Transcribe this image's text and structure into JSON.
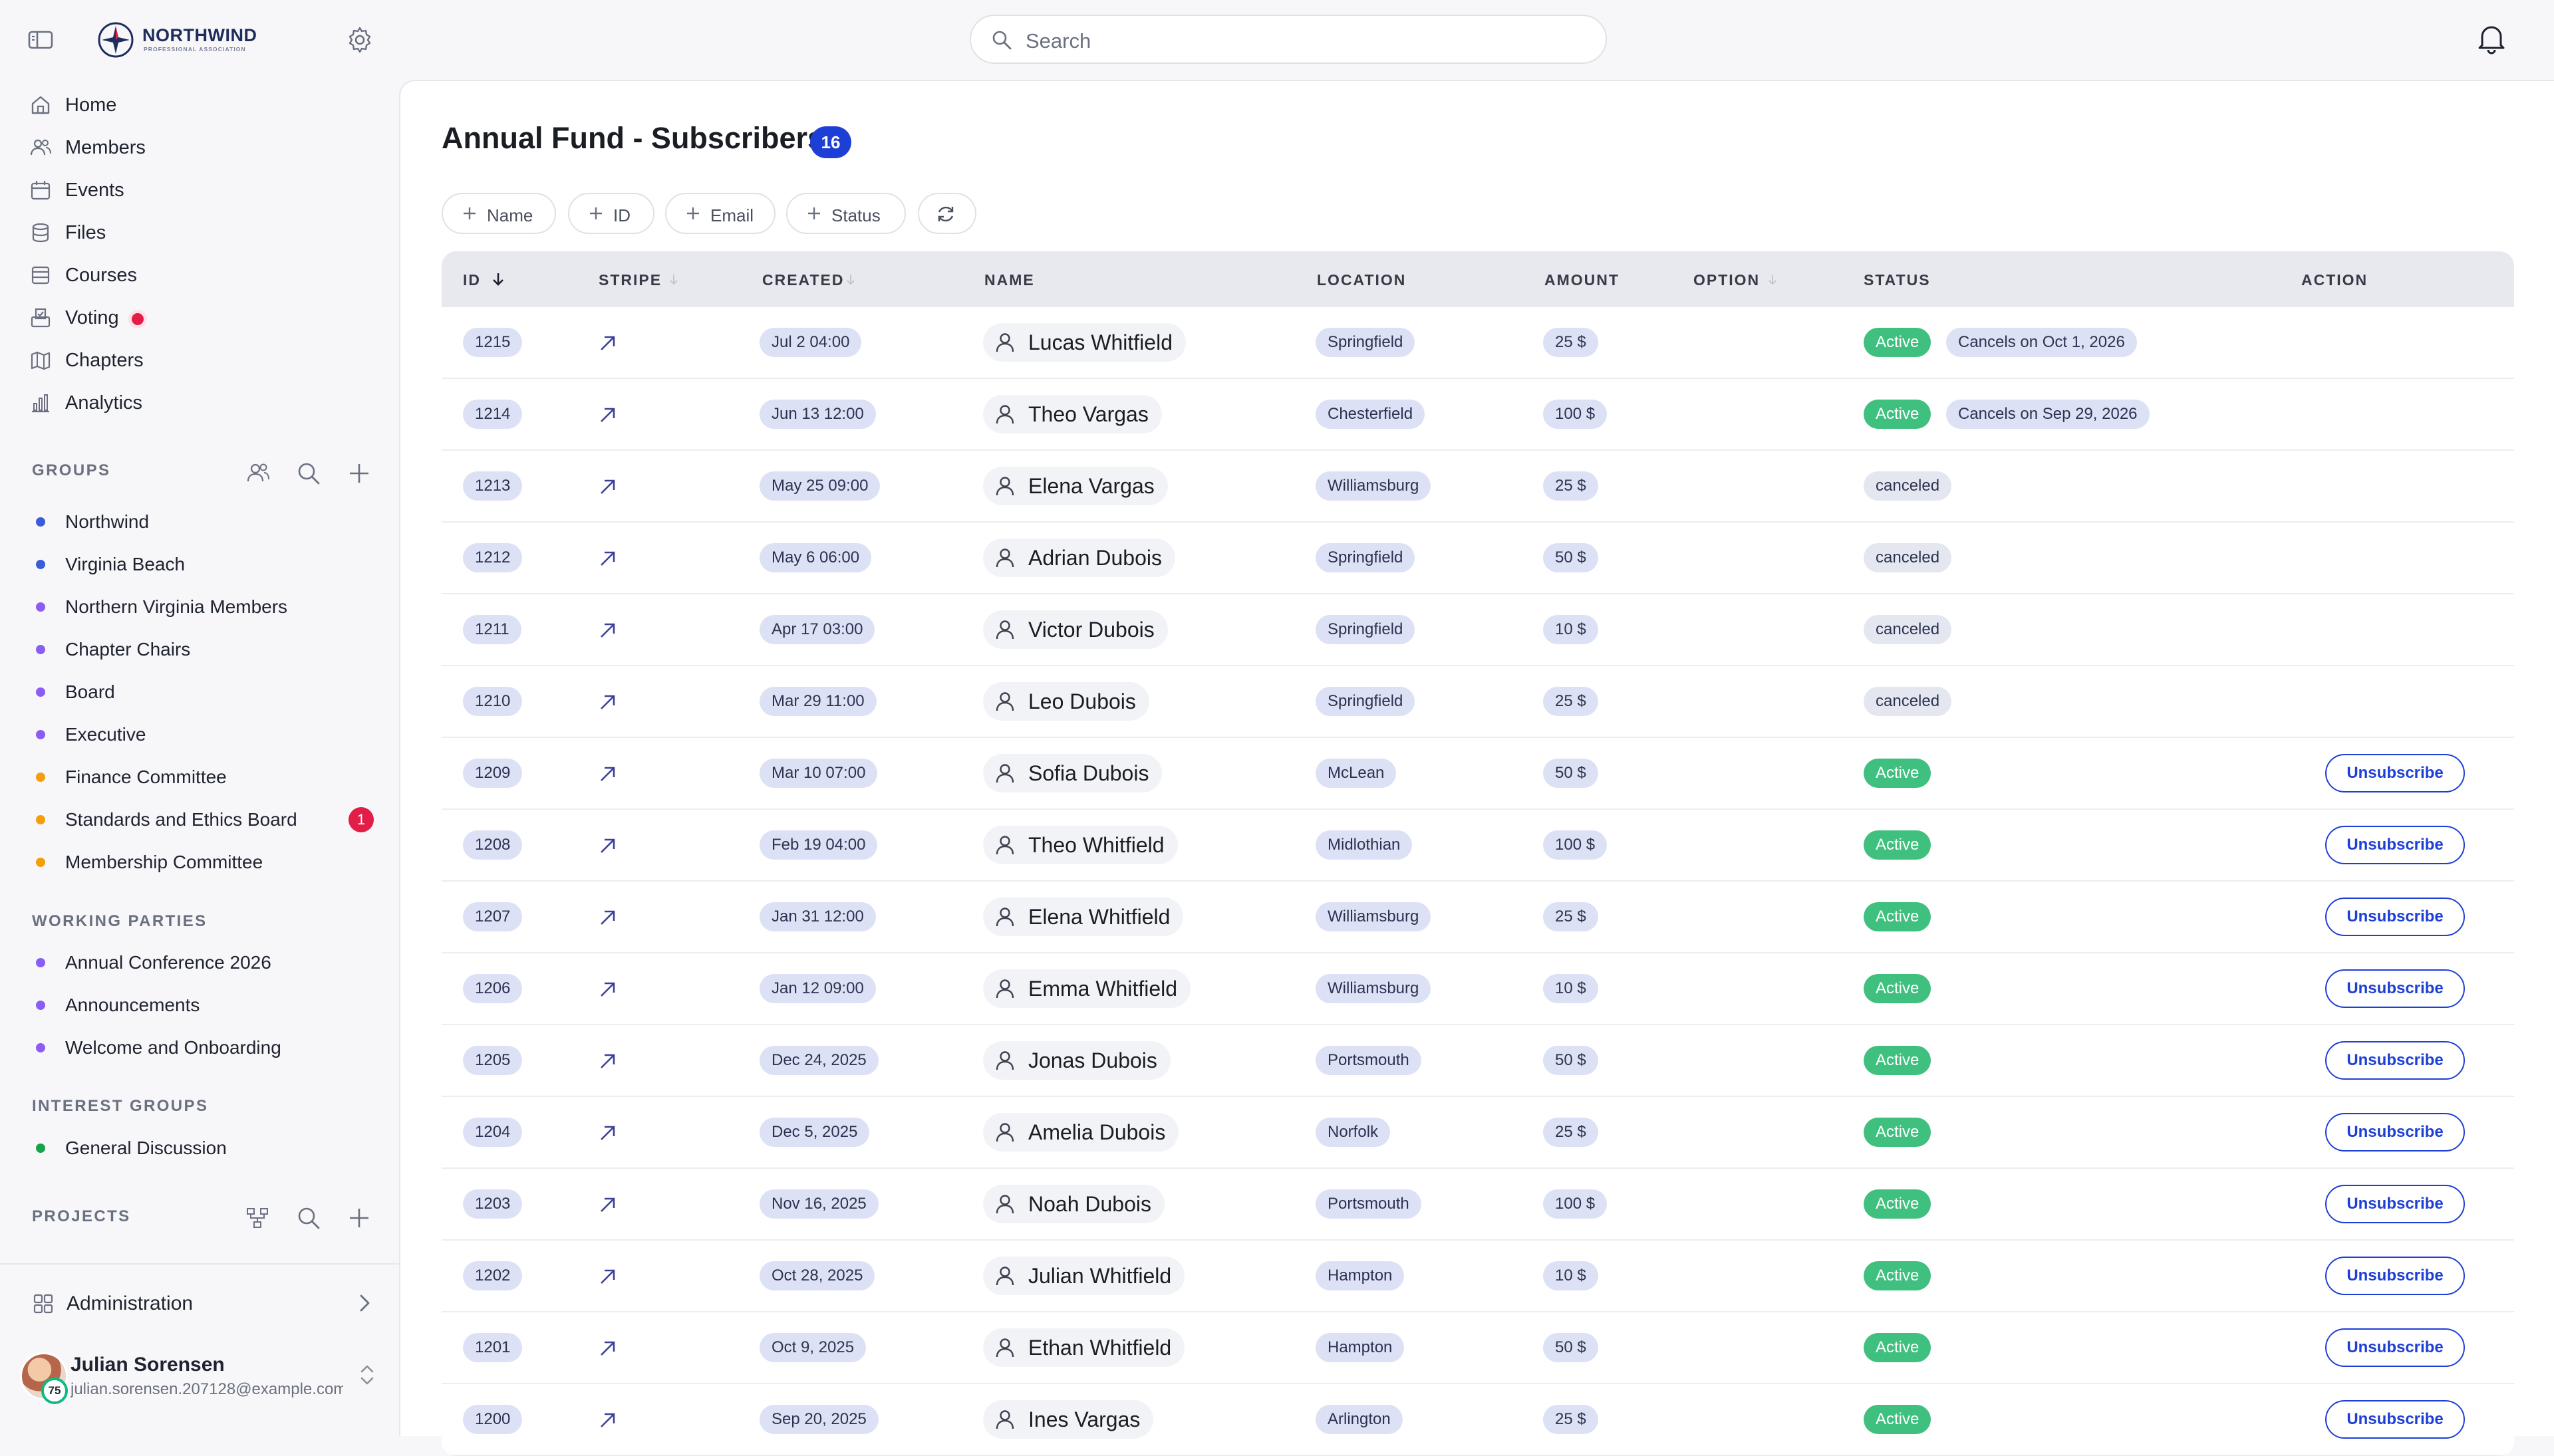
{
  "brand": {
    "name": "NORTHWIND",
    "tagline": "PROFESSIONAL ASSOCIATION"
  },
  "nav": [
    {
      "label": "Home",
      "icon": "home-icon"
    },
    {
      "label": "Members",
      "icon": "users-icon"
    },
    {
      "label": "Events",
      "icon": "calendar-icon"
    },
    {
      "label": "Files",
      "icon": "database-icon"
    },
    {
      "label": "Courses",
      "icon": "book-icon"
    },
    {
      "label": "Voting",
      "icon": "ballot-box-icon"
    },
    {
      "label": "Chapters",
      "icon": "map-icon"
    },
    {
      "label": "Analytics",
      "icon": "bar-chart-icon"
    }
  ],
  "sections": {
    "groups": "GROUPS",
    "working_parties": "WORKING PARTIES",
    "interest_groups": "INTEREST GROUPS",
    "projects": "PROJECTS"
  },
  "groups": [
    {
      "label": "Northwind",
      "color": "#3b5bdb"
    },
    {
      "label": "Virginia Beach",
      "color": "#3b5bdb"
    },
    {
      "label": "Northern Virginia Members",
      "color": "#8b5cf6"
    },
    {
      "label": "Chapter Chairs",
      "color": "#8b5cf6"
    },
    {
      "label": "Board",
      "color": "#8b5cf6"
    },
    {
      "label": "Executive",
      "color": "#8b5cf6"
    },
    {
      "label": "Finance Committee",
      "color": "#f59e0b"
    },
    {
      "label": "Standards and Ethics Board",
      "color": "#f59e0b",
      "badge": "1"
    },
    {
      "label": "Membership Committee",
      "color": "#f59e0b"
    }
  ],
  "working_parties": [
    {
      "label": "Annual Conference 2026",
      "color": "#8b5cf6"
    },
    {
      "label": "Announcements",
      "color": "#8b5cf6"
    },
    {
      "label": "Welcome and Onboarding",
      "color": "#8b5cf6"
    }
  ],
  "interest_groups": [
    {
      "label": "General Discussion",
      "color": "#16a34a"
    }
  ],
  "footer": {
    "admin_label": "Administration",
    "user_name": "Julian Sorensen",
    "user_email": "julian.sorensen.207128@example.com",
    "avatar_badge": "75"
  },
  "search": {
    "placeholder": "Search"
  },
  "page": {
    "title": "Annual Fund - Subscribers",
    "count": "16"
  },
  "filters": [
    "Name",
    "ID",
    "Email",
    "Status"
  ],
  "columns": {
    "id": "ID",
    "stripe": "STRIPE",
    "created": "CREATED",
    "name": "NAME",
    "location": "LOCATION",
    "amount": "AMOUNT",
    "option": "OPTION",
    "status": "STATUS",
    "action": "ACTION"
  },
  "action_label": "Unsubscribe",
  "colors": {
    "accent": "#1d3fd6",
    "active": "#3fc07e",
    "alert": "#e11d48"
  },
  "rows": [
    {
      "id": "1215",
      "created": "Jul 2 04:00",
      "name": "Lucas Whitfield",
      "location": "Springfield",
      "amount": "25 $",
      "status": "Active",
      "note": "Cancels on Oct 1, 2026",
      "action": false
    },
    {
      "id": "1214",
      "created": "Jun 13 12:00",
      "name": "Theo Vargas",
      "location": "Chesterfield",
      "amount": "100 $",
      "status": "Active",
      "note": "Cancels on Sep 29, 2026",
      "action": false
    },
    {
      "id": "1213",
      "created": "May 25 09:00",
      "name": "Elena Vargas",
      "location": "Williamsburg",
      "amount": "25 $",
      "status": "canceled",
      "note": "",
      "action": false
    },
    {
      "id": "1212",
      "created": "May 6 06:00",
      "name": "Adrian Dubois",
      "location": "Springfield",
      "amount": "50 $",
      "status": "canceled",
      "note": "",
      "action": false
    },
    {
      "id": "1211",
      "created": "Apr 17 03:00",
      "name": "Victor Dubois",
      "location": "Springfield",
      "amount": "10 $",
      "status": "canceled",
      "note": "",
      "action": false
    },
    {
      "id": "1210",
      "created": "Mar 29 11:00",
      "name": "Leo Dubois",
      "location": "Springfield",
      "amount": "25 $",
      "status": "canceled",
      "note": "",
      "action": false
    },
    {
      "id": "1209",
      "created": "Mar 10 07:00",
      "name": "Sofia Dubois",
      "location": "McLean",
      "amount": "50 $",
      "status": "Active",
      "note": "",
      "action": true
    },
    {
      "id": "1208",
      "created": "Feb 19 04:00",
      "name": "Theo Whitfield",
      "location": "Midlothian",
      "amount": "100 $",
      "status": "Active",
      "note": "",
      "action": true
    },
    {
      "id": "1207",
      "created": "Jan 31 12:00",
      "name": "Elena Whitfield",
      "location": "Williamsburg",
      "amount": "25 $",
      "status": "Active",
      "note": "",
      "action": true
    },
    {
      "id": "1206",
      "created": "Jan 12 09:00",
      "name": "Emma Whitfield",
      "location": "Williamsburg",
      "amount": "10 $",
      "status": "Active",
      "note": "",
      "action": true
    },
    {
      "id": "1205",
      "created": "Dec 24, 2025",
      "name": "Jonas Dubois",
      "location": "Portsmouth",
      "amount": "50 $",
      "status": "Active",
      "note": "",
      "action": true
    },
    {
      "id": "1204",
      "created": "Dec 5, 2025",
      "name": "Amelia Dubois",
      "location": "Norfolk",
      "amount": "25 $",
      "status": "Active",
      "note": "",
      "action": true
    },
    {
      "id": "1203",
      "created": "Nov 16, 2025",
      "name": "Noah Dubois",
      "location": "Portsmouth",
      "amount": "100 $",
      "status": "Active",
      "note": "",
      "action": true
    },
    {
      "id": "1202",
      "created": "Oct 28, 2025",
      "name": "Julian Whitfield",
      "location": "Hampton",
      "amount": "10 $",
      "status": "Active",
      "note": "",
      "action": true
    },
    {
      "id": "1201",
      "created": "Oct 9, 2025",
      "name": "Ethan Whitfield",
      "location": "Hampton",
      "amount": "50 $",
      "status": "Active",
      "note": "",
      "action": true
    },
    {
      "id": "1200",
      "created": "Sep 20, 2025",
      "name": "Ines Vargas",
      "location": "Arlington",
      "amount": "25 $",
      "status": "Active",
      "note": "",
      "action": true
    }
  ]
}
